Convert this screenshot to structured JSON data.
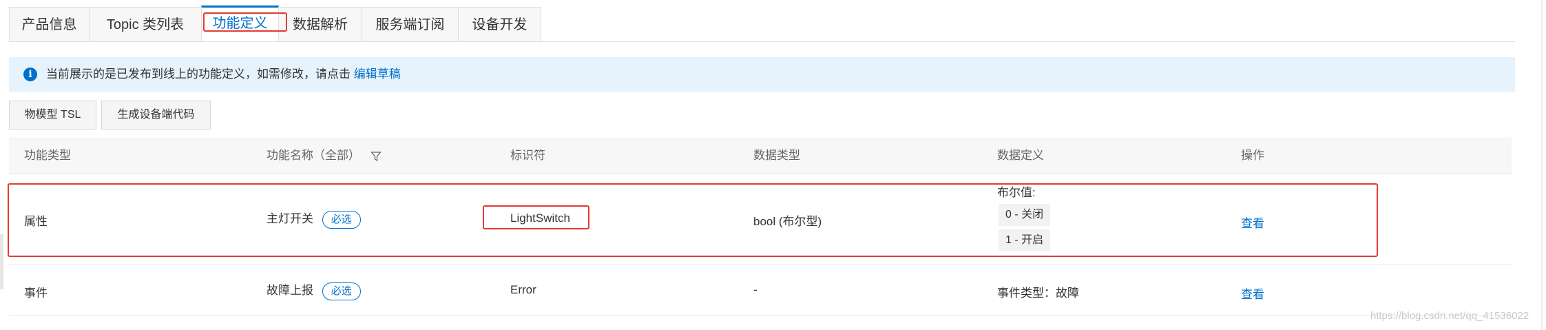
{
  "tabs": [
    {
      "label": "产品信息",
      "active": false
    },
    {
      "label": "Topic 类列表",
      "active": false
    },
    {
      "label": "功能定义",
      "active": true
    },
    {
      "label": "数据解析",
      "active": false
    },
    {
      "label": "服务端订阅",
      "active": false
    },
    {
      "label": "设备开发",
      "active": false
    }
  ],
  "banner": {
    "icon": "info-icon",
    "text": "当前展示的是已发布到线上的功能定义，如需修改，请点击",
    "link": "编辑草稿"
  },
  "buttons": {
    "tsl": "物模型 TSL",
    "generate_code": "生成设备端代码"
  },
  "table": {
    "headers": {
      "type": "功能类型",
      "name": "功能名称（全部）",
      "identifier": "标识符",
      "data_type": "数据类型",
      "data_def": "数据定义",
      "action": "操作"
    },
    "rows": [
      {
        "type": "属性",
        "name": "主灯开关",
        "badge": "必选",
        "identifier": "LightSwitch",
        "data_type": "bool (布尔型)",
        "data_def_title": "布尔值:",
        "data_def_items": [
          "0 - 关闭",
          "1 - 开启"
        ],
        "action": "查看"
      },
      {
        "type": "事件",
        "name": "故障上报",
        "badge": "必选",
        "identifier": "Error",
        "data_type": "-",
        "data_def_text": "事件类型：故障",
        "action": "查看"
      }
    ]
  },
  "watermark": "https://blog.csdn.net/qq_41536022",
  "colors": {
    "accent": "#0070cc",
    "highlight_border": "#e53935",
    "banner_bg": "#e6f3fd"
  }
}
